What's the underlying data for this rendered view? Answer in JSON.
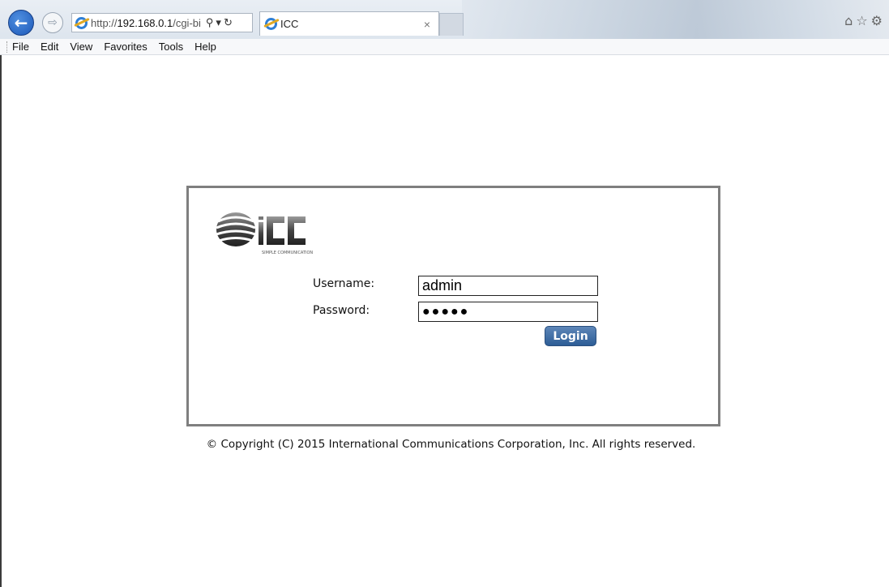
{
  "browser": {
    "address_prefix": "http://",
    "address_host": "192.168.0.1",
    "address_suffix": "/cgi-bi",
    "tab_title": "ICC",
    "tab_close": "×",
    "menu": [
      "File",
      "Edit",
      "View",
      "Favorites",
      "Tools",
      "Help"
    ]
  },
  "logo": {
    "text": "ICC",
    "tagline": "SIMPLE COMMUNICATION"
  },
  "login": {
    "username_label": "Username:",
    "username_value": "admin",
    "password_label": "Password:",
    "password_value": "●●●●●",
    "login_button": "Login"
  },
  "footer": {
    "copyright": "© Copyright (C) 2015 International Communications Corporation, Inc. All rights reserved."
  },
  "colors": {
    "login_button": "#3e6ea6",
    "box_border": "#7f7f7f",
    "logo_gray": "#555555"
  }
}
